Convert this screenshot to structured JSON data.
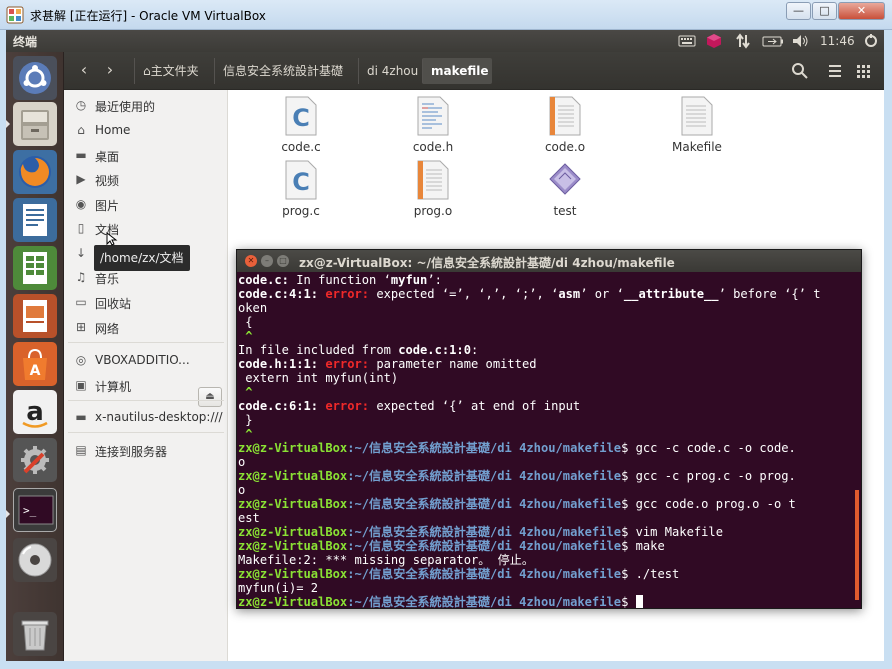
{
  "vbox": {
    "title": "求甚解 [正在运行] - Oracle VM VirtualBox",
    "minimize": "—",
    "maximize": "□",
    "close": "✕"
  },
  "panel": {
    "app_title": "终端",
    "clock": "11:46"
  },
  "launcher": {
    "items": [
      {
        "name": "dash-home"
      },
      {
        "name": "files"
      },
      {
        "name": "firefox"
      },
      {
        "name": "libreoffice-writer"
      },
      {
        "name": "libreoffice-calc"
      },
      {
        "name": "libreoffice-impress"
      },
      {
        "name": "ubuntu-software-center"
      },
      {
        "name": "amazon"
      },
      {
        "name": "system-settings"
      },
      {
        "name": "terminal"
      },
      {
        "name": "cd-drive"
      },
      {
        "name": "trash"
      }
    ]
  },
  "nautilus": {
    "breadcrumbs": [
      "主文件夹",
      "信息安全系统設計基礎",
      "di 4zhou",
      "makefile"
    ],
    "sidebar": [
      {
        "label": "最近使用的",
        "icon": "clock-icon"
      },
      {
        "label": "Home",
        "icon": "home-icon"
      },
      {
        "label": "桌面",
        "icon": "folder-icon"
      },
      {
        "label": "视频",
        "icon": "video-icon"
      },
      {
        "label": "图片",
        "icon": "camera-icon"
      },
      {
        "label": "文档",
        "icon": "document-icon"
      },
      {
        "label": "下载",
        "icon": "download-icon"
      },
      {
        "label": "音乐",
        "icon": "music-icon"
      },
      {
        "label": "回收站",
        "icon": "trash-icon"
      },
      {
        "label": "网络",
        "icon": "network-icon"
      },
      {
        "label": "VBOXADDITIO...",
        "icon": "disc-icon"
      },
      {
        "label": "计算机",
        "icon": "computer-icon"
      },
      {
        "label": "x-nautilus-desktop:///",
        "icon": "folder-icon"
      },
      {
        "label": "连接到服务器",
        "icon": "server-icon"
      }
    ],
    "tooltip": "/home/zx/文档",
    "files": [
      {
        "name": "code.c",
        "type": "c-source"
      },
      {
        "name": "code.h",
        "type": "header"
      },
      {
        "name": "code.o",
        "type": "object"
      },
      {
        "name": "Makefile",
        "type": "text"
      },
      {
        "name": "prog.c",
        "type": "c-source"
      },
      {
        "name": "prog.o",
        "type": "object"
      },
      {
        "name": "test",
        "type": "executable"
      }
    ]
  },
  "terminal": {
    "title": "zx@z-VirtualBox: ~/信息安全系統設計基礎/di 4zhou/makefile",
    "prompt_user": "zx@z-VirtualBox",
    "prompt_path": ":~/信息安全系統設計基礎/di 4zhou/makefile",
    "prompt_end": "$ ",
    "err_word": "error:",
    "lines": {
      "l1_file": "code.c:",
      "l1_rest": " In function ‘",
      "l1_fn": "myfun",
      "l1_end": "’:",
      "l2_loc": "code.c:4:1:",
      "l2_msg": " expected ‘=’, ‘,’, ‘;’, ‘",
      "l2_asm": "asm",
      "l2_mid": "’ or ‘",
      "l2_attr": "__attribute__",
      "l2_end": "’ before ‘{’ t",
      "l3": "oken",
      "l4": " {",
      "l5": " ^",
      "l6_pre": "In file included from ",
      "l6_loc": "code.c:1:0",
      "l6_end": ":",
      "l7_loc": "code.h:1:1:",
      "l7_msg": " parameter name omitted",
      "l8": " extern int myfun(int)",
      "l9": " ^",
      "l10_loc": "code.c:6:1:",
      "l10_msg": " expected ‘{’ at end of input",
      "l11": " }",
      "l12": " ^",
      "cmd1": "gcc -c code.c -o code.",
      "cmd1_wrap": "o",
      "cmd2": "gcc -c prog.c -o prog.",
      "cmd2_wrap": "o",
      "cmd3": "gcc code.o prog.o -o t",
      "cmd3_wrap": "est",
      "cmd4": "vim Makefile",
      "cmd5": "make",
      "make_out": "Makefile:2: *** missing separator。 停止。",
      "cmd6": "./test",
      "test_out": "myfun(i)= 2"
    }
  },
  "colors": {
    "terminal_bg": "#300a24",
    "prompt_green": "#8ae234",
    "prompt_blue": "#729fcf",
    "error_red": "#ef2929"
  }
}
